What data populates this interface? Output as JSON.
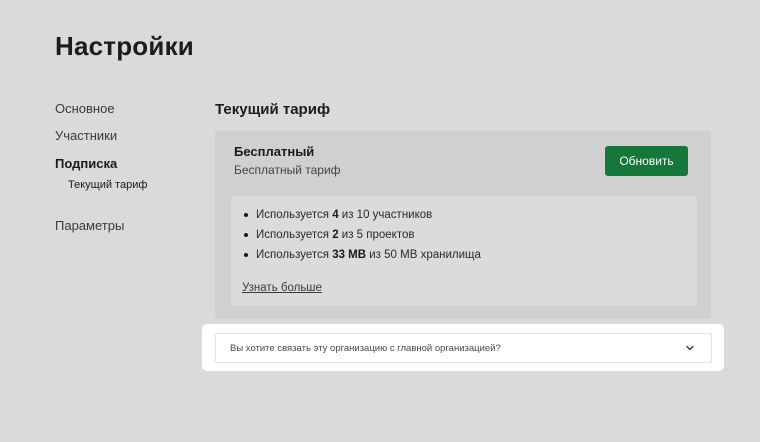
{
  "page": {
    "title": "Настройки"
  },
  "sidebar": {
    "items": [
      {
        "label": "Основное"
      },
      {
        "label": "Участники"
      },
      {
        "label": "Подписка"
      },
      {
        "label": "Параметры"
      }
    ],
    "sub_items": [
      {
        "label": "Текущий тариф"
      }
    ]
  },
  "main": {
    "section_title": "Текущий тариф",
    "plan": {
      "name": "Бесплатный",
      "description": "Бесплатный тариф",
      "upgrade_label": "Обновить"
    },
    "usage": [
      {
        "prefix": "Используется ",
        "value": "4",
        "suffix": " из 10 участников"
      },
      {
        "prefix": "Используется ",
        "value": "2",
        "suffix": " из 5 проектов"
      },
      {
        "prefix": "Используется ",
        "value": "33 MB",
        "suffix": " из 50 MB хранилища"
      }
    ],
    "learn_more_label": "Узнать больше",
    "link_org": {
      "question": "Вы хотите связать эту организацию с главной организацией?"
    }
  },
  "colors": {
    "background": "#dadada",
    "card": "#d0d0d0",
    "accent": "#15773a"
  }
}
